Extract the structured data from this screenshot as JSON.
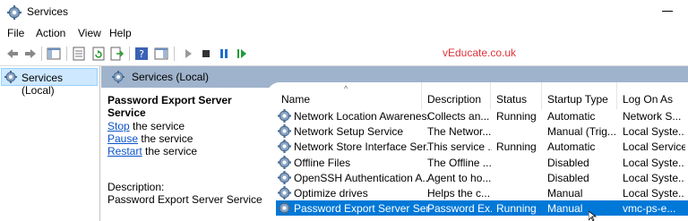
{
  "window": {
    "title": "Services"
  },
  "menu": [
    "File",
    "Action",
    "View",
    "Help"
  ],
  "watermark": "vEducate.co.uk",
  "toolbar": {
    "icons": [
      "back-icon",
      "forward-icon",
      "show-console-tree-icon",
      "properties-icon",
      "refresh-icon",
      "export-list-icon",
      "help-icon",
      "show-hide-action-pane-icon",
      "start-service-icon",
      "stop-service-icon",
      "pause-service-icon",
      "restart-service-icon"
    ]
  },
  "tree": {
    "item": "Services (Local)"
  },
  "pane_header": {
    "title": "Services (Local)"
  },
  "extended": {
    "service_name": "Password Export Server Service",
    "actions": [
      {
        "link": "Stop",
        "rest": " the service"
      },
      {
        "link": "Pause",
        "rest": " the service"
      },
      {
        "link": "Restart",
        "rest": " the service"
      }
    ],
    "description_label": "Description:",
    "description": "Password Export Server Service"
  },
  "columns": [
    "Name",
    "Description",
    "Status",
    "Startup Type",
    "Log On As"
  ],
  "rows": [
    {
      "name": "Network Location Awareness",
      "description": "Collects an...",
      "status": "Running",
      "startup": "Automatic",
      "logon": "Network S..."
    },
    {
      "name": "Network Setup Service",
      "description": "The Networ...",
      "status": "",
      "startup": "Manual (Trig...",
      "logon": "Local Syste..."
    },
    {
      "name": "Network Store Interface Ser...",
      "description": "This service ...",
      "status": "Running",
      "startup": "Automatic",
      "logon": "Local Service"
    },
    {
      "name": "Offline Files",
      "description": "The Offline ...",
      "status": "",
      "startup": "Disabled",
      "logon": "Local Syste..."
    },
    {
      "name": "OpenSSH Authentication A...",
      "description": "Agent to ho...",
      "status": "",
      "startup": "Disabled",
      "logon": "Local Syste..."
    },
    {
      "name": "Optimize drives",
      "description": "Helps the c...",
      "status": "",
      "startup": "Manual",
      "logon": "Local Syste..."
    },
    {
      "name": "Password Export Server Serv...",
      "description": "Password Ex...",
      "status": "Running",
      "startup": "Manual",
      "logon": "vmc-ps-e..."
    }
  ],
  "selected_row": 6,
  "colors": {
    "selection": "#0078d7",
    "pane_header": "#9fb3cc",
    "link": "#0a53c9",
    "watermark": "#e0333a"
  }
}
